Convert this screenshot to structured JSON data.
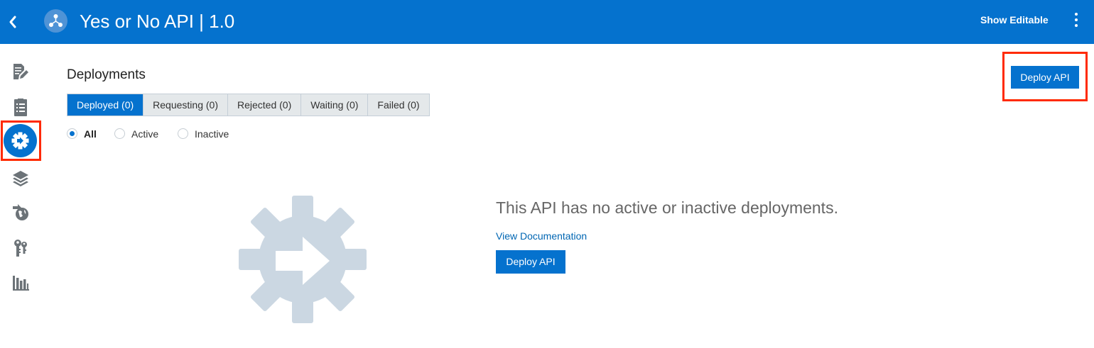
{
  "header": {
    "title": "Yes or No API | 1.0",
    "show_editable": "Show Editable",
    "back_icon": "chevron-left-icon",
    "logo_icon": "api-nodes-icon",
    "menu_icon": "kebab-menu-icon"
  },
  "sidebar": {
    "items": [
      {
        "icon": "document-edit-icon",
        "active": false
      },
      {
        "icon": "api-implementation-icon",
        "active": false
      },
      {
        "icon": "deployments-gear-icon",
        "active": true
      },
      {
        "icon": "layers-icon",
        "active": false
      },
      {
        "icon": "publish-globe-icon",
        "active": false
      },
      {
        "icon": "grants-keys-icon",
        "active": false
      },
      {
        "icon": "analytics-bar-chart-icon",
        "active": false
      }
    ]
  },
  "main": {
    "title": "Deployments",
    "deploy_button": "Deploy API",
    "tabs": [
      {
        "label": "Deployed (0)",
        "active": true
      },
      {
        "label": "Requesting (0)",
        "active": false
      },
      {
        "label": "Rejected (0)",
        "active": false
      },
      {
        "label": "Waiting (0)",
        "active": false
      },
      {
        "label": "Failed (0)",
        "active": false
      }
    ],
    "filters": [
      {
        "label": "All",
        "selected": true
      },
      {
        "label": "Active",
        "selected": false
      },
      {
        "label": "Inactive",
        "selected": false
      }
    ],
    "empty_state": {
      "message": "This API has no active or inactive deployments.",
      "link": "View Documentation",
      "button": "Deploy API",
      "icon": "deploy-gear-arrow-icon"
    }
  },
  "colors": {
    "brand_blue": "#0572ce",
    "highlight_red": "#ff2a00",
    "empty_icon": "#cbd7e2",
    "sidebar_icon": "#6c7378"
  }
}
